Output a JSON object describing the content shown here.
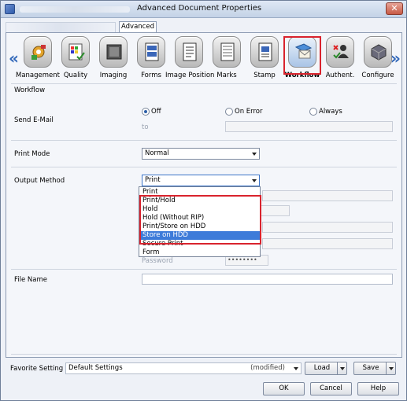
{
  "window": {
    "title": "Advanced Document Properties",
    "close_glyph": "✕",
    "tabs": [
      {
        "label": "Advanced"
      }
    ]
  },
  "icons": [
    {
      "label": "Management",
      "icon": "management-icon"
    },
    {
      "label": "Quality",
      "icon": "quality-icon"
    },
    {
      "label": "Imaging",
      "icon": "imaging-icon"
    },
    {
      "label": "Forms",
      "icon": "forms-icon"
    },
    {
      "label": "Image Position",
      "icon": "image-position-icon"
    },
    {
      "label": "Marks",
      "icon": "marks-icon"
    },
    {
      "label": "Stamp",
      "icon": "stamp-icon"
    },
    {
      "label": "Workflow",
      "icon": "workflow-icon"
    },
    {
      "label": "Authent.",
      "icon": "authentication-icon"
    },
    {
      "label": "Configure",
      "icon": "configure-icon"
    }
  ],
  "nav": {
    "left": "«",
    "right": "»"
  },
  "workflow": {
    "heading": "Workflow",
    "send_email": {
      "label": "Send E-Mail",
      "options": [
        "Off",
        "On Error",
        "Always"
      ],
      "selected": "Off",
      "to_label": "to"
    },
    "print_mode": {
      "label": "Print Mode",
      "value": "Normal"
    },
    "output_method": {
      "label": "Output Method",
      "value": "Print",
      "options": [
        "Print",
        "Print/Hold",
        "Hold",
        "Hold (Without RIP)",
        "Print/Store on HDD",
        "Store on HDD",
        "Secure Print",
        "Form"
      ],
      "highlighted": "Store on HDD"
    },
    "password_label": "Password",
    "password_value": "••••••••",
    "file_name": {
      "label": "File Name",
      "value": ""
    }
  },
  "footer": {
    "favorite_label": "Favorite Setting",
    "favorite_value": "Default Settings",
    "modified": "(modified)",
    "load": "Load",
    "save": "Save",
    "ok": "OK",
    "cancel": "Cancel",
    "help": "Help"
  },
  "colors": {
    "highlight": "#d9232d",
    "selection": "#3d7bd9",
    "radio_dot": "#2d5fa8"
  }
}
